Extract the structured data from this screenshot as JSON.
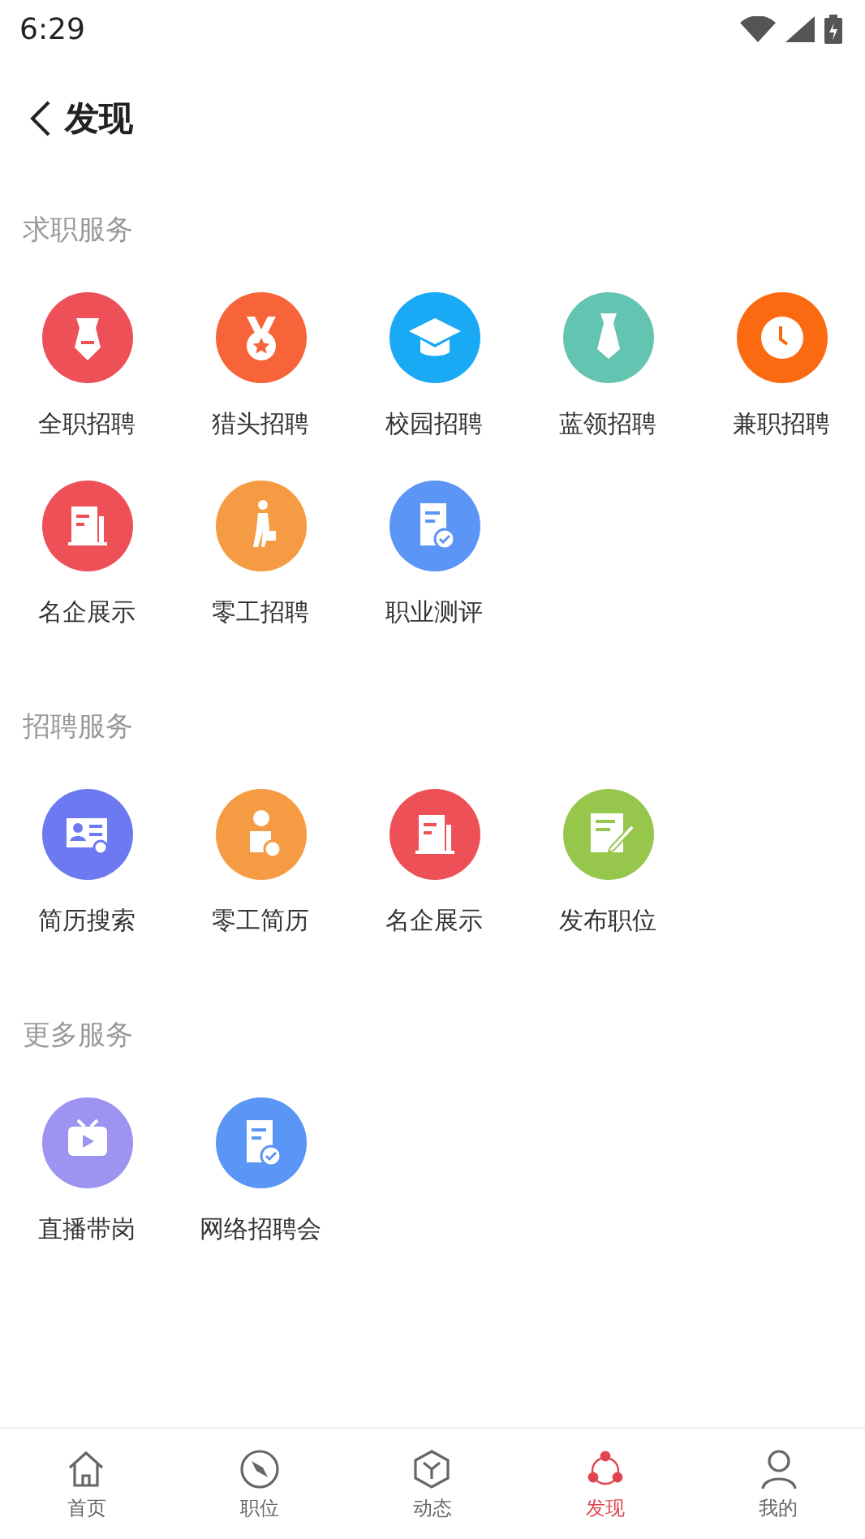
{
  "status_bar": {
    "time": "6:29"
  },
  "header": {
    "title": "发现"
  },
  "sections": [
    {
      "title": "求职服务",
      "items": [
        {
          "label": "全职招聘",
          "kind": "tie",
          "color": "#ee5058"
        },
        {
          "label": "猎头招聘",
          "kind": "medal",
          "color": "#f7643a"
        },
        {
          "label": "校园招聘",
          "kind": "cap",
          "color": "#1aa9f5"
        },
        {
          "label": "蓝领招聘",
          "kind": "necktie",
          "color": "#64c4b2"
        },
        {
          "label": "兼职招聘",
          "kind": "clock",
          "color": "#fb6a10"
        },
        {
          "label": "名企展示",
          "kind": "building",
          "color": "#ee5058"
        },
        {
          "label": "零工招聘",
          "kind": "worker",
          "color": "#f59b43"
        },
        {
          "label": "职业测评",
          "kind": "doccheck",
          "color": "#5b95f6"
        }
      ]
    },
    {
      "title": "招聘服务",
      "items": [
        {
          "label": "简历搜索",
          "kind": "card",
          "color": "#6c79f0"
        },
        {
          "label": "零工简历",
          "kind": "personsearch",
          "color": "#f59b43"
        },
        {
          "label": "名企展示",
          "kind": "building",
          "color": "#ee5058"
        },
        {
          "label": "发布职位",
          "kind": "edit",
          "color": "#96c64c"
        }
      ]
    },
    {
      "title": "更多服务",
      "items": [
        {
          "label": "直播带岗",
          "kind": "tv",
          "color": "#9d93f0"
        },
        {
          "label": "网络招聘会",
          "kind": "doccheck",
          "color": "#5b95f6"
        }
      ]
    }
  ],
  "tabs": [
    {
      "label": "首页",
      "kind": "home",
      "selected": false
    },
    {
      "label": "职位",
      "kind": "compass",
      "selected": false
    },
    {
      "label": "动态",
      "kind": "cube",
      "selected": false
    },
    {
      "label": "发现",
      "kind": "discover",
      "selected": true
    },
    {
      "label": "我的",
      "kind": "user",
      "selected": false
    }
  ]
}
